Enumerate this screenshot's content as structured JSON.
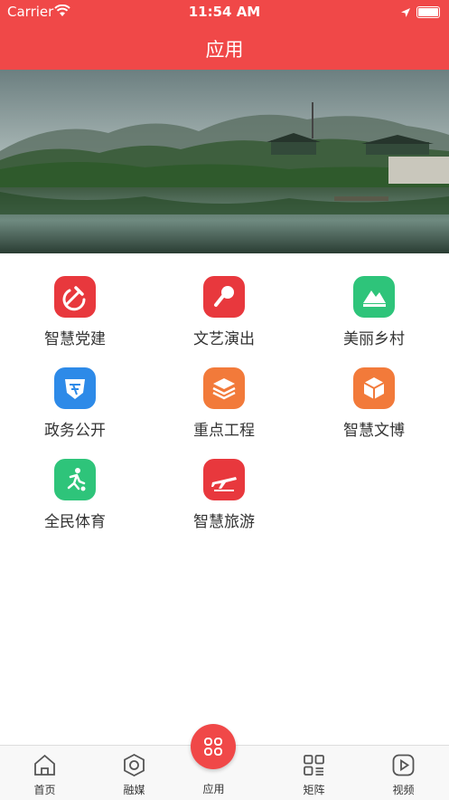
{
  "status": {
    "carrier": "Carrier",
    "time": "11:54 AM"
  },
  "nav": {
    "title": "应用"
  },
  "apps": [
    {
      "label": "智慧党建",
      "icon": "party-hammer-sickle-icon",
      "color": "#e8383d"
    },
    {
      "label": "文艺演出",
      "icon": "microphone-icon",
      "color": "#e8383d"
    },
    {
      "label": "美丽乡村",
      "icon": "mountain-icon",
      "color": "#2ec47a"
    },
    {
      "label": "政务公开",
      "icon": "shield-icon",
      "color": "#2d8ae8"
    },
    {
      "label": "重点工程",
      "icon": "layers-icon",
      "color": "#f27a3a"
    },
    {
      "label": "智慧文博",
      "icon": "box-icon",
      "color": "#f27a3a"
    },
    {
      "label": "全民体育",
      "icon": "runner-icon",
      "color": "#2ec47a"
    },
    {
      "label": "智慧旅游",
      "icon": "airplane-icon",
      "color": "#e8383d"
    }
  ],
  "tabs": [
    {
      "label": "首页",
      "icon": "home-icon"
    },
    {
      "label": "融媒",
      "icon": "media-icon"
    },
    {
      "label": "应用",
      "icon": "apps-icon"
    },
    {
      "label": "矩阵",
      "icon": "matrix-icon"
    },
    {
      "label": "视频",
      "icon": "video-play-icon"
    }
  ],
  "colors": {
    "brand": "#f04848"
  }
}
